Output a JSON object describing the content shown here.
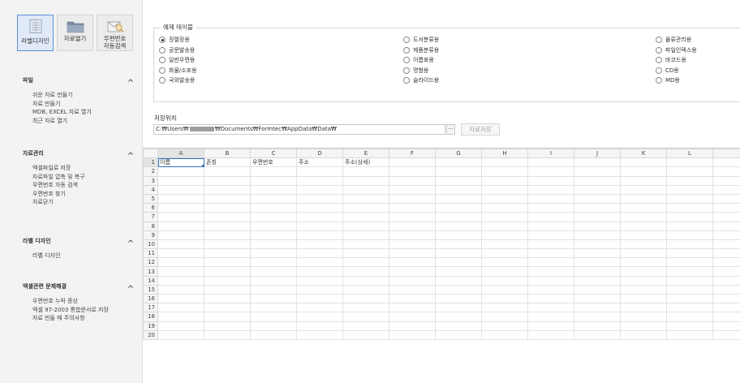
{
  "sidebar": {
    "toolbar": [
      {
        "label": "라벨디자인",
        "icon": "label-design-icon",
        "active": true
      },
      {
        "label": "자료열기",
        "icon": "folder-icon",
        "active": false
      },
      {
        "label": "우편번호\n자동검색",
        "icon": "postal-search-icon",
        "active": false
      }
    ],
    "sections": [
      {
        "title": "파일",
        "items": [
          "쉬운 자료 만들기",
          "자료 만들기",
          "MDB, EXCEL 자료 열기",
          "최근 자료 열기"
        ]
      },
      {
        "title": "자료관리",
        "items": [
          "엑셀파일로 저장",
          "자료파일 압축 및 복구",
          "우편번호 자동 검색",
          "우편번호 찾기",
          "자료닫기"
        ]
      },
      {
        "title": "라벨 디자인",
        "items": [
          "라벨 디자인"
        ]
      },
      {
        "title": "엑셀관련 문제해결",
        "items": [
          "우편번호 누락 증상",
          "엑셀 97-2003 통합문서로 저장",
          "자료 만들 때 주의사항"
        ]
      }
    ]
  },
  "example_table": {
    "title": "예제 테이블",
    "columns": [
      [
        {
          "label": "정렬장용",
          "selected": true
        },
        {
          "label": "공문발송용",
          "selected": false
        },
        {
          "label": "일반우편용",
          "selected": false
        },
        {
          "label": "화물/소포용",
          "selected": false
        },
        {
          "label": "국외발송용",
          "selected": false
        }
      ],
      [
        {
          "label": "도서분류용",
          "selected": false
        },
        {
          "label": "제품분류용",
          "selected": false
        },
        {
          "label": "이름표용",
          "selected": false
        },
        {
          "label": "명함용",
          "selected": false
        },
        {
          "label": "슬라이드용",
          "selected": false
        }
      ],
      [
        {
          "label": "물류관리용",
          "selected": false
        },
        {
          "label": "파일인덱스용",
          "selected": false
        },
        {
          "label": "바코드용",
          "selected": false
        },
        {
          "label": "CD용",
          "selected": false
        },
        {
          "label": "MD용",
          "selected": false
        }
      ]
    ]
  },
  "save_location": {
    "label": "저장위치",
    "path_prefix": "C:₩Users₩",
    "path_suffix": "₩Documents₩Formtec₩AppData₩Data₩",
    "browse_label": "···",
    "save_button": "자료저장"
  },
  "grid": {
    "columns": [
      "A",
      "B",
      "C",
      "D",
      "E",
      "F",
      "G",
      "H",
      "I",
      "J",
      "K",
      "L"
    ],
    "row_count": 20,
    "header_row": [
      "이름",
      "존칭",
      "우편번호",
      "주소",
      "주소(상세)",
      "",
      "",
      "",
      "",
      "",
      "",
      ""
    ],
    "active_cell": "A1"
  },
  "colors": {
    "accent": "#2f6fbf",
    "sidebar_bg": "#f3f3f3",
    "active_button_bg": "#dfe9f7"
  }
}
